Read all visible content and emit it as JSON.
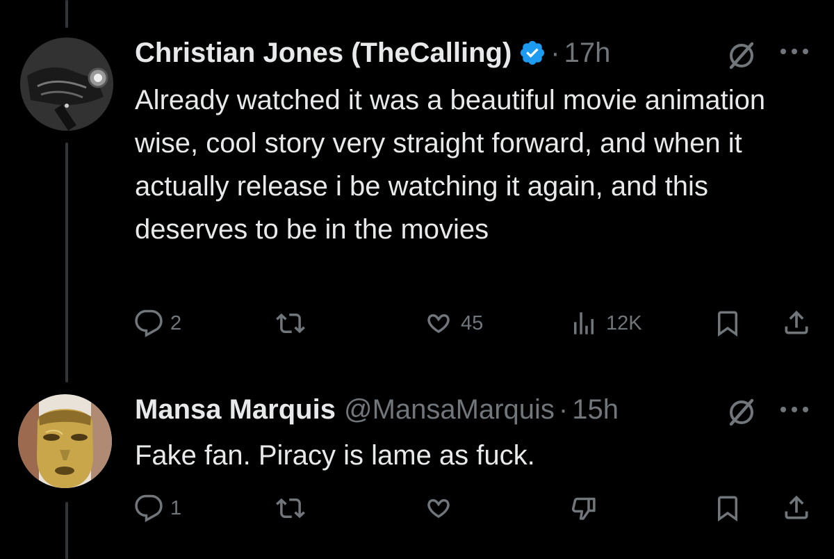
{
  "tweets": [
    {
      "name": "Christian Jones (TheCalling)",
      "handle": "",
      "time": "17h",
      "verified": true,
      "text": "Already watched it was a beautiful movie animation wise, cool story very straight forward, and when it actually release i be watching it again, and this deserves to be in the movies",
      "actions": {
        "replies": "2",
        "reposts": "",
        "likes": "45",
        "views": "12K"
      },
      "icons": [
        "reply-icon",
        "repost-icon",
        "like-icon",
        "views-icon",
        "bookmark-icon",
        "share-icon",
        "grok-icon",
        "more-icon"
      ]
    },
    {
      "name": "Mansa Marquis",
      "handle": "@MansaMarquis",
      "time": "15h",
      "verified": false,
      "text": "Fake fan. Piracy is lame as fuck.",
      "actions": {
        "replies": "1",
        "reposts": "",
        "likes": "",
        "views": ""
      },
      "icons": [
        "reply-icon",
        "repost-icon",
        "like-icon",
        "downvote-icon",
        "bookmark-icon",
        "share-icon",
        "grok-icon",
        "more-icon"
      ]
    }
  ],
  "colors": {
    "background": "#000000",
    "text": "#e7e9ea",
    "muted": "#71767b",
    "verified": "#1d9bf0",
    "thread_line": "#333639"
  },
  "dot_separator": "·"
}
